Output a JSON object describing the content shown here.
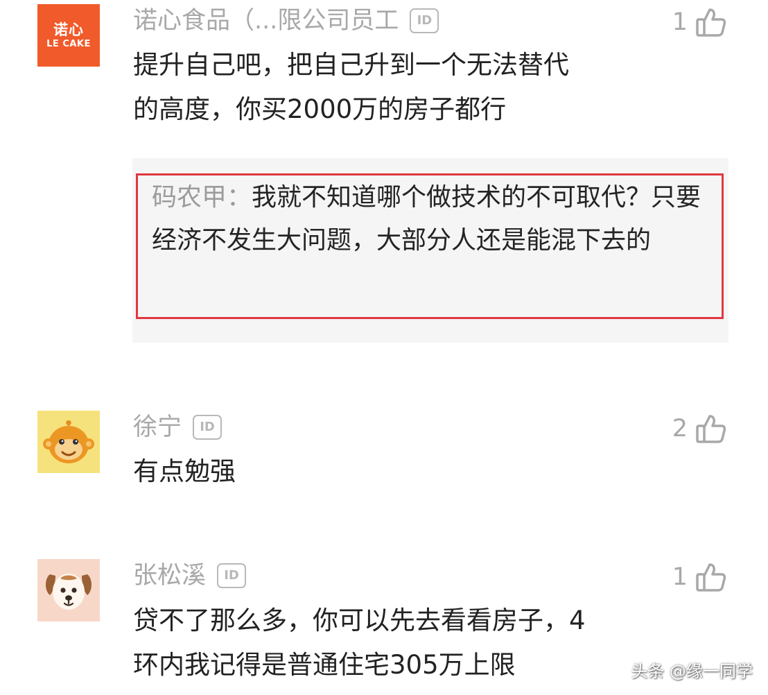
{
  "comments": [
    {
      "avatar_icon": "le-cake-logo",
      "avatar_logo_cn": "诺心",
      "avatar_logo_en": "LE CAKE",
      "name": "诺心食品（...限公司员工",
      "badge": "ID",
      "likes": "1",
      "lines": [
        "提升自己吧，把自己升到一个无法替代",
        "的高度，你买2000万的房子都行"
      ],
      "reply": {
        "author": "码农甲：",
        "text": "我就不知道哪个做技术的不可取代？只要经济不发生大问题，大部分人还是能混下去的"
      }
    },
    {
      "avatar_icon": "cartoon-monkey-avatar",
      "name": "徐宁",
      "badge": "ID",
      "likes": "2",
      "lines": [
        "有点勉强"
      ]
    },
    {
      "avatar_icon": "cartoon-dog-avatar",
      "name": "张松溪",
      "badge": "ID",
      "likes": "1",
      "lines": [
        "贷不了那么多，你可以先去看看房子，4",
        "环内我记得是普通住宅305万上限"
      ]
    }
  ],
  "watermark": "头条 @缘一同学",
  "colors": {
    "brand_orange": "#f15a2b",
    "highlight_red": "#e0383f",
    "reply_bg": "#f5f5f6",
    "meta_gray": "#a8a8a8",
    "text_dark": "#222222"
  }
}
